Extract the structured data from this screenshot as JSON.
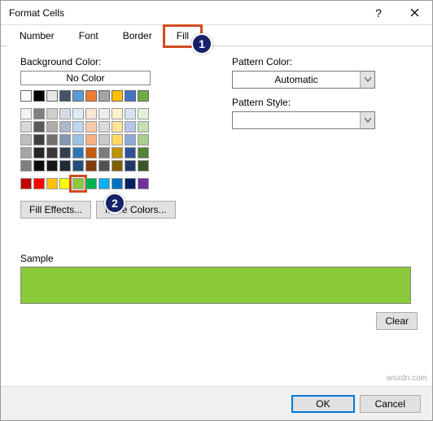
{
  "title": "Format Cells",
  "tabs": {
    "number": "Number",
    "font": "Font",
    "border": "Border",
    "fill": "Fill"
  },
  "badges": {
    "one": "1",
    "two": "2"
  },
  "labels": {
    "bgcolor": "Background Color:",
    "nocolor": "No Color",
    "fillEffects": "Fill Effects...",
    "moreColors": "More Colors...",
    "patternColor": "Pattern Color:",
    "automatic": "Automatic",
    "patternStyle": "Pattern Style:",
    "sample": "Sample",
    "clear": "Clear",
    "ok": "OK",
    "cancel": "Cancel"
  },
  "colors": {
    "sample": "#8ac93a",
    "selected": "#8ac93a",
    "row1": [
      "#ffffff",
      "#000000",
      "#e7e6e6",
      "#44546a",
      "#5b9bd5",
      "#ed7d31",
      "#a5a5a5",
      "#ffc000",
      "#4472c4",
      "#70ad47"
    ],
    "row2": [
      "#f2f2f2",
      "#808080",
      "#d0cece",
      "#d6dce4",
      "#deebf6",
      "#fbe5d5",
      "#ededed",
      "#fff2cc",
      "#d9e2f3",
      "#e2efd9"
    ],
    "row3": [
      "#d8d8d8",
      "#595959",
      "#aeabab",
      "#adb9ca",
      "#bdd7ee",
      "#f7cbac",
      "#dbdbdb",
      "#fee599",
      "#b4c6e7",
      "#c5e0b3"
    ],
    "row4": [
      "#bfbfbf",
      "#3f3f3f",
      "#757070",
      "#8496b0",
      "#9cc3e5",
      "#f4b183",
      "#c9c9c9",
      "#ffd965",
      "#8eaadb",
      "#a8d08d"
    ],
    "row5": [
      "#a5a5a5",
      "#262626",
      "#3a3838",
      "#323f4f",
      "#2e75b5",
      "#c55a11",
      "#7b7b7b",
      "#bf9000",
      "#2f5496",
      "#538135"
    ],
    "row6": [
      "#7f7f7f",
      "#0c0c0c",
      "#171616",
      "#222a35",
      "#1e4e79",
      "#833c0b",
      "#525252",
      "#7f6000",
      "#1f3864",
      "#375623"
    ],
    "std": [
      "#c00000",
      "#ff0000",
      "#ffc000",
      "#ffff00",
      "#8ac93a",
      "#00b050",
      "#00b0f0",
      "#0070c0",
      "#002060",
      "#7030a0"
    ]
  },
  "watermark": "wsxdn.com"
}
